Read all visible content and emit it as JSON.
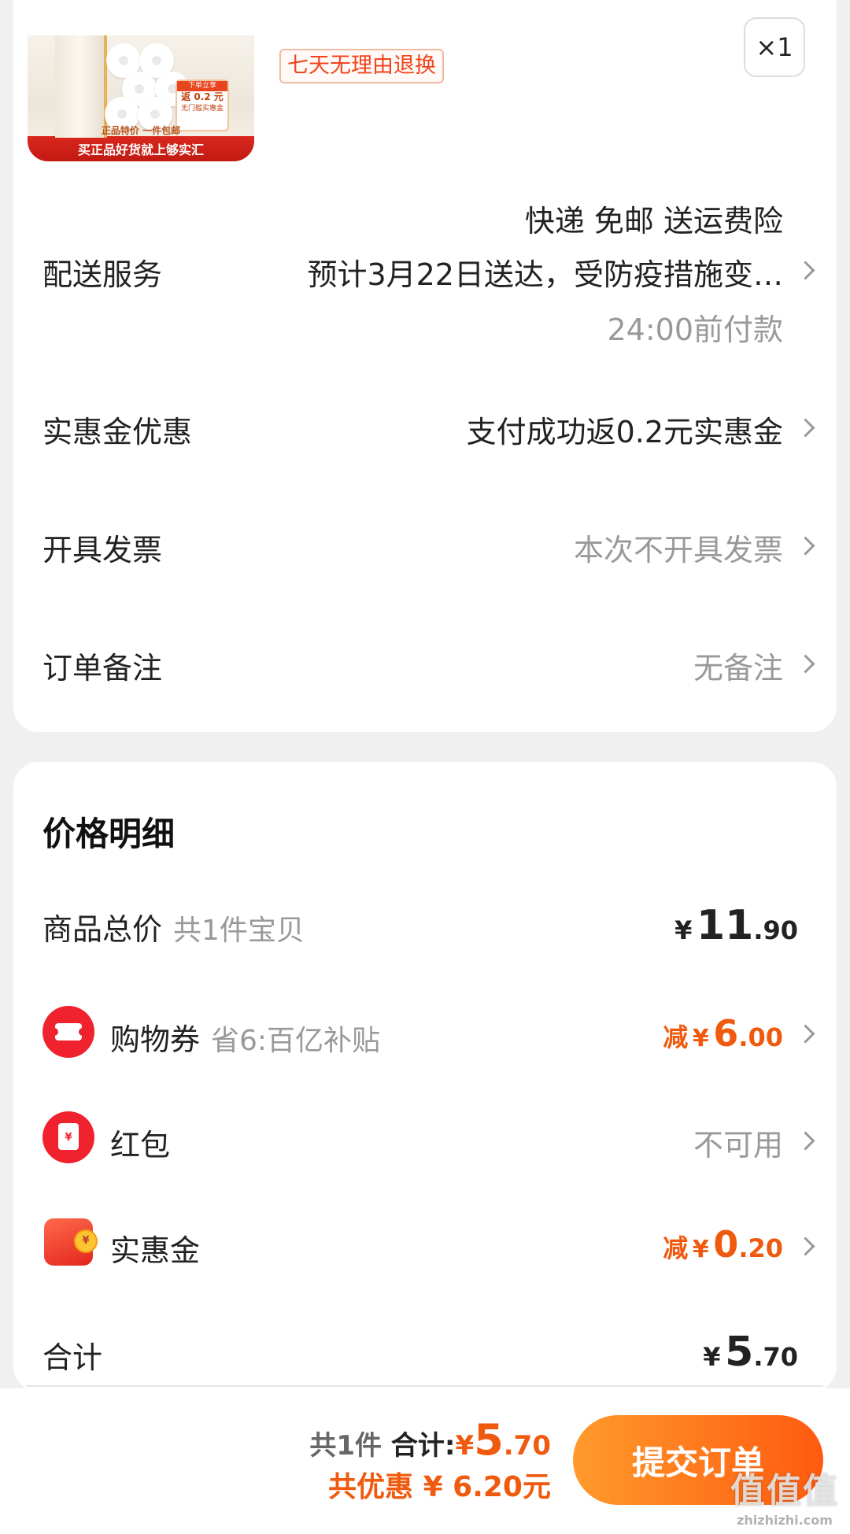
{
  "product": {
    "image_bottom_text": "买正品好货就上够实汇",
    "image_mid_text": "正品特价  一件包邮",
    "image_tag_header": "下单立享",
    "image_tag_line1": "返 0.2 元",
    "image_tag_line2": "无门槛实惠金",
    "return_badge": "七天无理由退换",
    "quantity": "×1"
  },
  "delivery": {
    "label": "配送服务",
    "line1": "快递 免邮 送运费险",
    "line2": "预计3月22日送达，受防疫措施变…",
    "line3": "24:00前付款"
  },
  "discount": {
    "label": "实惠金优惠",
    "value": "支付成功返0.2元实惠金"
  },
  "invoice": {
    "label": "开具发票",
    "value": "本次不开具发票"
  },
  "remark": {
    "label": "订单备注",
    "value": "无备注"
  },
  "price_detail": {
    "title": "价格明细",
    "goods_total": {
      "label": "商品总价",
      "sub": "共1件宝贝",
      "currency": "¥",
      "int": "11",
      "dec": ".90"
    },
    "coupon": {
      "label": "购物券",
      "sub": "省6:百亿补贴",
      "prefix": "减",
      "currency": "¥",
      "int": "6",
      "dec": ".00"
    },
    "red_packet": {
      "label": "红包",
      "value": "不可用",
      "icon_glyph": "¥"
    },
    "shihuijin": {
      "label": "实惠金",
      "prefix": "减",
      "currency": "¥",
      "int": "0",
      "dec": ".20",
      "icon_glyph": "¥"
    },
    "total": {
      "label": "合计",
      "currency": "¥",
      "int": "5",
      "dec": ".70"
    }
  },
  "bottom_bar": {
    "count_text": "共1件",
    "total_label": "合计:",
    "currency": "¥",
    "int": "5",
    "dec": ".70",
    "saved_text": "共优惠 ¥ 6.20元",
    "submit_label": "提交订单"
  },
  "watermark": {
    "big": "值值值",
    "small": "zhizhizhi.com"
  },
  "colors": {
    "accent_orange": "#f05a0e",
    "button_gradient_start": "#ff9a2b",
    "button_gradient_end": "#ff5a10",
    "icon_red": "#f0222e"
  }
}
